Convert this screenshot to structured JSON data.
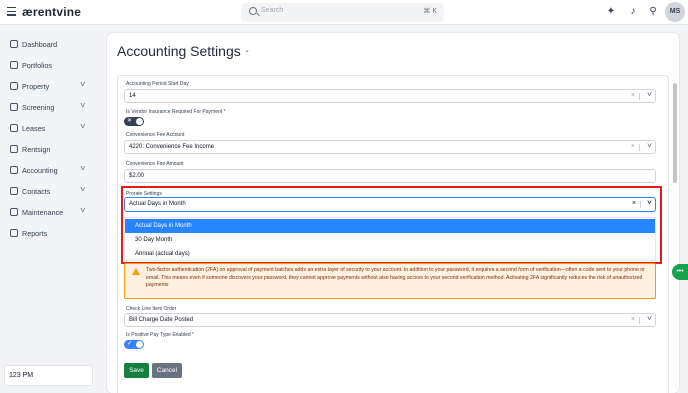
{
  "header": {
    "logo": "ærentvine",
    "search_placeholder": "Search",
    "search_shortcut": "⌘ K",
    "avatar_initials": "MS",
    "icons": [
      "sparkle-icon",
      "bell-icon",
      "user-icon"
    ]
  },
  "sidebar": {
    "items": [
      {
        "label": "Dashboard",
        "icon": "grid-icon",
        "expandable": false
      },
      {
        "label": "Portfolios",
        "icon": "folder-icon",
        "expandable": false
      },
      {
        "label": "Property",
        "icon": "home-icon",
        "expandable": true
      },
      {
        "label": "Screening",
        "icon": "screening-icon",
        "expandable": true
      },
      {
        "label": "Leases",
        "icon": "lease-icon",
        "expandable": true
      },
      {
        "label": "Rentsign",
        "icon": "pen-icon",
        "expandable": false
      },
      {
        "label": "Accounting",
        "icon": "dollar-icon",
        "expandable": true
      },
      {
        "label": "Contacts",
        "icon": "contacts-icon",
        "expandable": true
      },
      {
        "label": "Maintenance",
        "icon": "wrench-icon",
        "expandable": true
      },
      {
        "label": "Reports",
        "icon": "reports-icon",
        "expandable": false
      }
    ],
    "time": "123 PM"
  },
  "page": {
    "title": "Accounting Settings"
  },
  "form": {
    "period_start_label": "Accounting Period Start Day",
    "period_start_value": "14",
    "vendor_insurance_label": "Is Vendor Insurance Required For Payment *",
    "vendor_insurance_enabled": false,
    "conv_fee_account_label": "Convenience Fee Account",
    "conv_fee_account_value": "4220: Convenience Fee Income",
    "conv_fee_amount_label": "Convenience Fee Amount",
    "conv_fee_amount_value": "$2.00",
    "prorate_label": "Prorate Settings",
    "prorate_value": "Actual Days in Month",
    "prorate_options": [
      "Actual Days in Month",
      "30 Day Month",
      "Annual (actual days)"
    ],
    "warning_text": "Two-factor authentication (2FA) on approval of payment batches adds an extra layer of security to your account. In addition to your password, it requires a second form of verification—often a code sent to your phone or email. This means even if someone discovers your password, they cannot approve payments without also having access to your second verification method. Activating 2FA significantly reduces the risk of unauthorized payments",
    "check_order_label": "Check Line Item Order",
    "check_order_value": "Bill Charge Date Posted",
    "positive_pay_label": "Is Positive Pay Type Enabled *",
    "positive_pay_enabled": true,
    "save_label": "Save",
    "cancel_label": "Cancel"
  },
  "colors": {
    "accent": "#2684ff",
    "save": "#15803d",
    "highlight_border": "#e11d1d",
    "warning_border": "#f59e0b"
  }
}
